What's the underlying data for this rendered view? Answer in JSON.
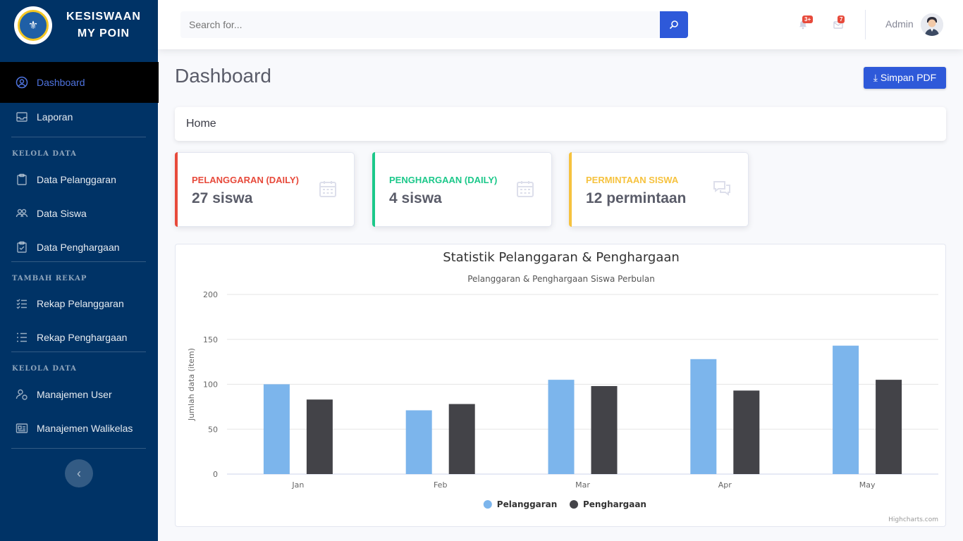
{
  "brand": {
    "line1": "KESISWAAN",
    "line2": "MY POIN",
    "logo_text": "⚜"
  },
  "sidebar": {
    "active": {
      "label": "Dashboard",
      "icon": "user-circle-icon"
    },
    "items": [
      {
        "label": "Laporan",
        "icon": "inbox-icon"
      },
      {
        "label": "Data Pelanggaran",
        "icon": "clipboard-icon"
      },
      {
        "label": "Data Siswa",
        "icon": "users-icon"
      },
      {
        "label": "Data Penghargaan",
        "icon": "clipboard-check-icon"
      },
      {
        "label": "Rekap Pelanggaran",
        "icon": "checklist-icon"
      },
      {
        "label": "Rekap Penghargaan",
        "icon": "list-icon"
      },
      {
        "label": "Manajemen User",
        "icon": "user-gear-icon"
      },
      {
        "label": "Manajemen Walikelas",
        "icon": "id-card-icon"
      }
    ],
    "headings": [
      "KELOLA DATA",
      "TAMBAH REKAP",
      "KELOLA DATA"
    ],
    "toggle_icon": "‹"
  },
  "topbar": {
    "search_placeholder": "Search for...",
    "alerts_badge": "3+",
    "messages_badge": "7",
    "user_name": "Admin"
  },
  "page": {
    "title": "Dashboard",
    "pdf_button": "⤓ Simpan PDF",
    "breadcrumb": "Home"
  },
  "cards": [
    {
      "label": "PELANGGARAN (DAILY)",
      "value": "27 siswa",
      "color": "#e74a3b",
      "icon": "calendar-icon"
    },
    {
      "label": "PENGHARGAAN (DAILY)",
      "value": "4 siswa",
      "color": "#1cc88a",
      "icon": "calendar-icon"
    },
    {
      "label": "PERMINTAAN SISWA",
      "value": "12 permintaan",
      "color": "#f6c23e",
      "icon": "comments-icon"
    }
  ],
  "chart_data": {
    "type": "bar",
    "title": "Statistik Pelanggaran & Penghargaan",
    "subtitle": "Pelanggaran & Penghargaan Siswa Perbulan",
    "xlabel": "",
    "ylabel": "Jumlah data (item)",
    "categories": [
      "Jan",
      "Feb",
      "Mar",
      "Apr",
      "May"
    ],
    "ylim": [
      0,
      200
    ],
    "yticks": [
      0,
      50,
      100,
      150,
      200
    ],
    "grid": true,
    "legend": "bottom-center",
    "series": [
      {
        "name": "Pelanggaran",
        "color": "#7cb5ec",
        "values": [
          100,
          71,
          105,
          128,
          143
        ]
      },
      {
        "name": "Penghargaan",
        "color": "#434348",
        "values": [
          83,
          78,
          98,
          93,
          105
        ]
      }
    ],
    "credits": "Highcharts.com"
  }
}
